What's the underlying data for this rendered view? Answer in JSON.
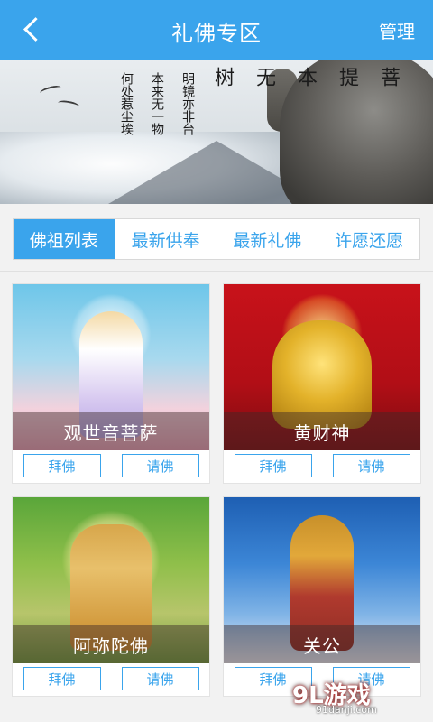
{
  "header": {
    "title": "礼佛专区",
    "right_action": "管理",
    "back_icon": "chevron-left-icon"
  },
  "banner": {
    "poem_big": [
      "菩",
      "提",
      "本",
      "无",
      "树"
    ],
    "poem_lines": [
      "明镜亦非台",
      "本来无一物",
      "何处惹尘埃"
    ]
  },
  "tabs": [
    {
      "label": "佛祖列表",
      "active": true
    },
    {
      "label": "最新供奉",
      "active": false
    },
    {
      "label": "最新礼佛",
      "active": false
    },
    {
      "label": "许愿还愿",
      "active": false
    }
  ],
  "cards": [
    {
      "name": "观世音菩萨",
      "btn1": "拜佛",
      "btn2": "请佛"
    },
    {
      "name": "黄财神",
      "btn1": "拜佛",
      "btn2": "请佛"
    },
    {
      "name": "阿弥陀佛",
      "btn1": "拜佛",
      "btn2": "请佛"
    },
    {
      "name": "关公",
      "btn1": "拜佛",
      "btn2": "请佛"
    }
  ],
  "watermark": {
    "logo": "9L游戏",
    "url": "91danji.com"
  },
  "colors": {
    "primary": "#3aa4ec",
    "background": "#f2f2f2"
  }
}
